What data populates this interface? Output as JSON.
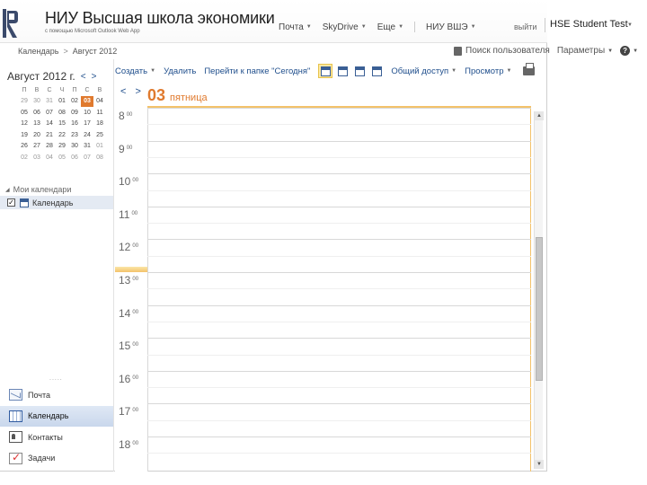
{
  "header": {
    "title": "НИУ Высшая школа экономики",
    "subtitle": "с помощью Microsoft Outlook Web App",
    "nav": [
      {
        "label": "Почта",
        "dropdown": true
      },
      {
        "label": "SkyDrive",
        "dropdown": true
      },
      {
        "label": "Еще",
        "dropdown": true
      },
      {
        "label": "НИУ ВШЭ",
        "dropdown": true
      }
    ],
    "signout": "выйти",
    "user": "HSE Student Test"
  },
  "breadcrumb": {
    "items": [
      "Календарь",
      "Август 2012"
    ],
    "separator": ">"
  },
  "rightlinks": {
    "search_people": "Поиск пользователя",
    "options": "Параметры",
    "help": "?"
  },
  "toolbar": {
    "create": "Создать",
    "delete": "Удалить",
    "goto": "Перейти к папке \"Сегодня\"",
    "share": "Общий доступ",
    "view": "Просмотр",
    "active_view": "day"
  },
  "minical": {
    "month_label": "Август 2012 г.",
    "weekdays": [
      "П",
      "В",
      "С",
      "Ч",
      "П",
      "С",
      "В"
    ],
    "weeks": [
      [
        "29",
        "30",
        "31",
        "01",
        "02",
        "03",
        "04"
      ],
      [
        "05",
        "06",
        "07",
        "08",
        "09",
        "10",
        "11"
      ],
      [
        "12",
        "13",
        "14",
        "15",
        "16",
        "17",
        "18"
      ],
      [
        "19",
        "20",
        "21",
        "22",
        "23",
        "24",
        "25"
      ],
      [
        "26",
        "27",
        "28",
        "29",
        "30",
        "31",
        "01"
      ],
      [
        "02",
        "03",
        "04",
        "05",
        "06",
        "07",
        "08"
      ]
    ],
    "today": "03",
    "nav_prev": "<",
    "nav_next": ">"
  },
  "folders": {
    "group": "Мои календари",
    "items": [
      {
        "label": "Календарь",
        "checked": true
      }
    ]
  },
  "grip": ".....",
  "modules": [
    {
      "label": "Почта",
      "icon": "mail-icon"
    },
    {
      "label": "Календарь",
      "icon": "calendar-icon",
      "active": true
    },
    {
      "label": "Контакты",
      "icon": "contacts-icon"
    },
    {
      "label": "Задачи",
      "icon": "tasks-icon"
    }
  ],
  "dayview": {
    "nav_prev": "<",
    "nav_next": ">",
    "day_num": "03",
    "day_name": "пятница",
    "hours": [
      "8",
      "9",
      "10",
      "11",
      "12",
      "13",
      "14",
      "15",
      "16",
      "17",
      "18"
    ],
    "minutes": "00",
    "now_hour": "13"
  },
  "colors": {
    "accent_orange": "#e07a2e",
    "link_blue": "#1f4e8c",
    "highlight_yellow": "#f3c26a",
    "selected_blue": "#c9d7ec"
  }
}
